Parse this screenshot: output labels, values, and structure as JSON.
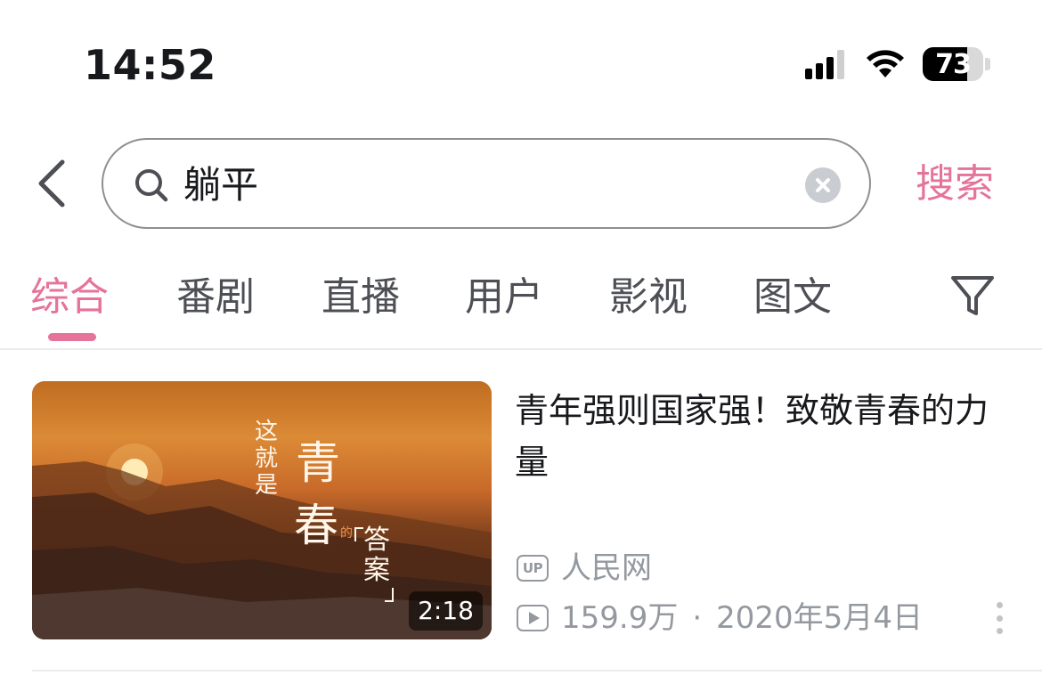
{
  "status_bar": {
    "time": "14:52",
    "battery_level": "73",
    "battery_fraction": 0.73,
    "icons": [
      "cellular-signal-icon",
      "wifi-icon",
      "battery-icon"
    ]
  },
  "search": {
    "back_icon": "chevron-left-icon",
    "query": "躺平",
    "search_icon": "search-icon",
    "clear_icon": "clear-icon",
    "submit_label": "搜索"
  },
  "tabs": {
    "items": [
      "综合",
      "番剧",
      "直播",
      "用户",
      "影视",
      "图文"
    ],
    "active": "综合",
    "filter_icon": "filter-icon"
  },
  "results": [
    {
      "title": "青年强则国家强！致敬青春的力量",
      "duration": "2:18",
      "thumbnail_text": {
        "small": "这就是",
        "big1": "青",
        "big2": "春",
        "tiny": "的",
        "answer": "答案"
      },
      "uploader_badge": "UP",
      "uploader": "人民网",
      "views": "159.9万",
      "separator": "·",
      "date": "2020年5月4日",
      "more_icon": "more-vertical-icon"
    }
  ],
  "colors": {
    "accent": "#e5739a",
    "text": "#18191c",
    "muted": "#9499a0"
  }
}
